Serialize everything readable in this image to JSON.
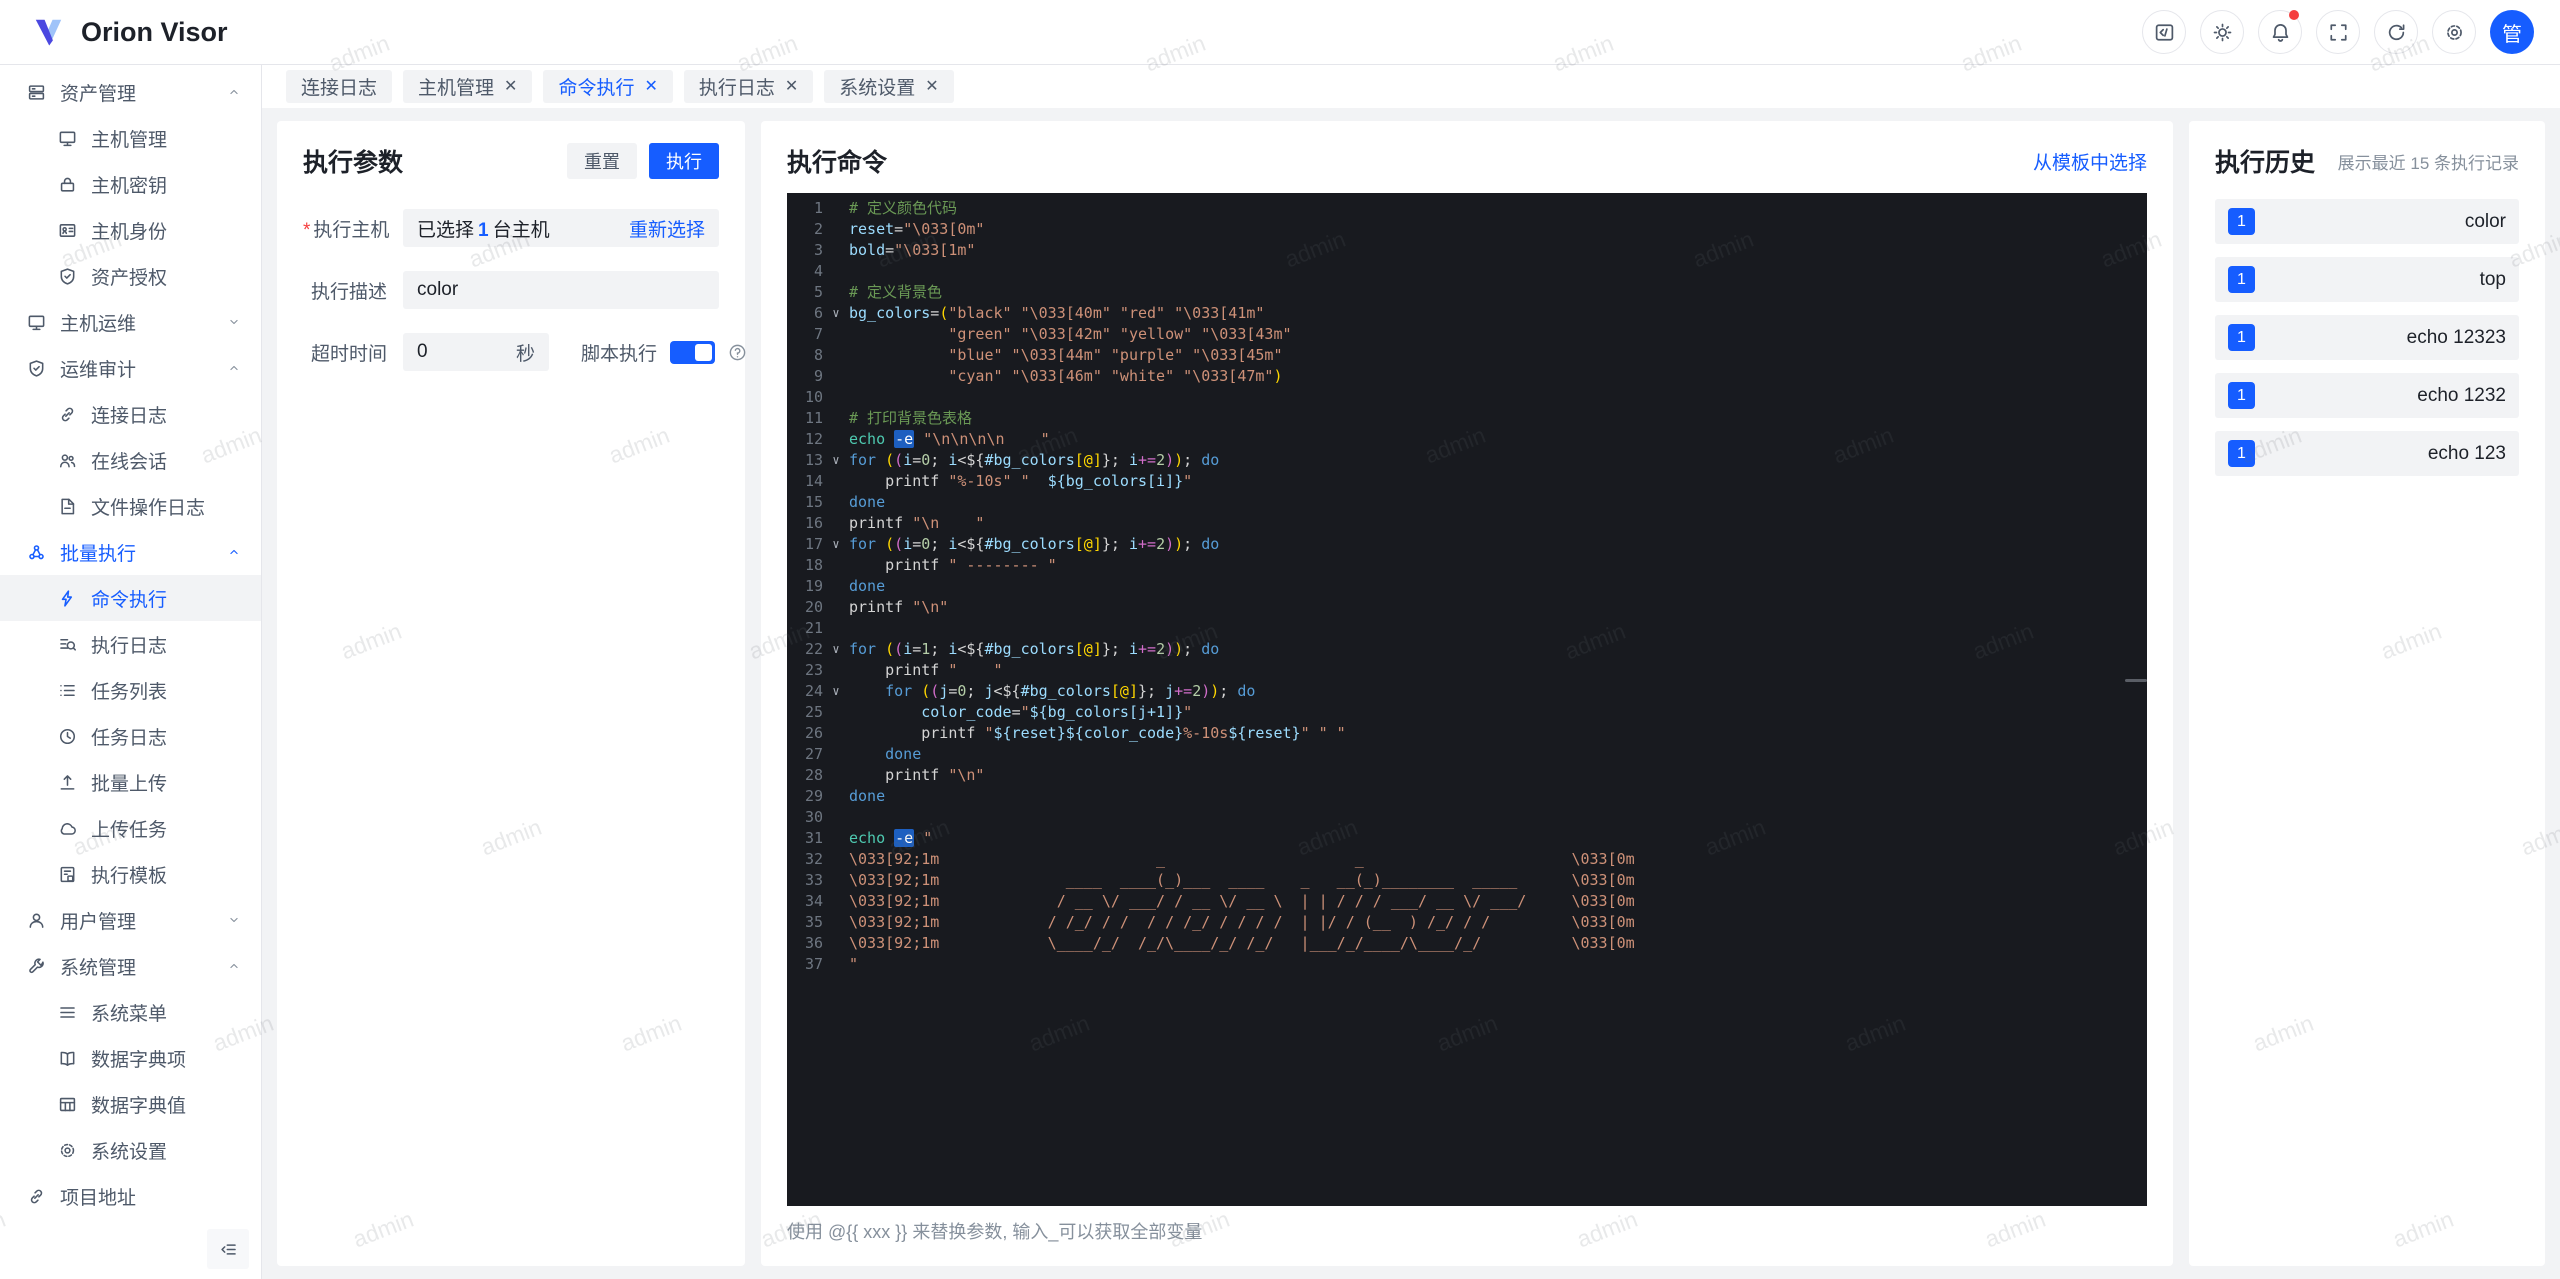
{
  "app": {
    "title": "Orion Visor",
    "avatar": "管"
  },
  "topbar": {
    "icons": [
      {
        "name": "code-square-icon",
        "icon": "codesq"
      },
      {
        "name": "theme-icon",
        "icon": "theme"
      },
      {
        "name": "notifications-icon",
        "icon": "bell",
        "badge": true
      },
      {
        "name": "fullscreen-icon",
        "icon": "fullscreen"
      },
      {
        "name": "refresh-icon",
        "icon": "refresh"
      },
      {
        "name": "settings-icon",
        "icon": "gear"
      }
    ]
  },
  "tabs": [
    {
      "label": "连接日志",
      "closable": false,
      "active": false
    },
    {
      "label": "主机管理",
      "closable": true,
      "active": false
    },
    {
      "label": "命令执行",
      "closable": true,
      "active": true
    },
    {
      "label": "执行日志",
      "closable": true,
      "active": false
    },
    {
      "label": "系统设置",
      "closable": true,
      "active": false
    }
  ],
  "sidebar": {
    "items": [
      {
        "label": "资产管理",
        "icon": "server",
        "level": 1,
        "chevron": "up"
      },
      {
        "label": "主机管理",
        "icon": "monitor",
        "level": 2
      },
      {
        "label": "主机密钥",
        "icon": "lock",
        "level": 2
      },
      {
        "label": "主机身份",
        "icon": "idcard",
        "level": 2
      },
      {
        "label": "资产授权",
        "icon": "shield",
        "level": 2
      },
      {
        "label": "主机运维",
        "icon": "monitor",
        "level": 1,
        "chevron": "down"
      },
      {
        "label": "运维审计",
        "icon": "shield",
        "level": 1,
        "chevron": "up"
      },
      {
        "label": "连接日志",
        "icon": "linkc",
        "level": 2
      },
      {
        "label": "在线会话",
        "icon": "users",
        "level": 2
      },
      {
        "label": "文件操作日志",
        "icon": "file",
        "level": 2
      },
      {
        "label": "批量执行",
        "icon": "cluster",
        "level": 1,
        "chevron": "up",
        "parent_active": true
      },
      {
        "label": "命令执行",
        "icon": "bolt",
        "level": 2,
        "active": true
      },
      {
        "label": "执行日志",
        "icon": "searchlist",
        "level": 2
      },
      {
        "label": "任务列表",
        "icon": "list",
        "level": 2
      },
      {
        "label": "任务日志",
        "icon": "clock",
        "level": 2
      },
      {
        "label": "批量上传",
        "icon": "upload",
        "level": 2
      },
      {
        "label": "上传任务",
        "icon": "cloud",
        "level": 2
      },
      {
        "label": "执行模板",
        "icon": "template",
        "level": 2
      },
      {
        "label": "用户管理",
        "icon": "user",
        "level": 1,
        "chevron": "down"
      },
      {
        "label": "系统管理",
        "icon": "wrench",
        "level": 1,
        "chevron": "up"
      },
      {
        "label": "系统菜单",
        "icon": "menu",
        "level": 2
      },
      {
        "label": "数据字典项",
        "icon": "book",
        "level": 2
      },
      {
        "label": "数据字典值",
        "icon": "tablei",
        "level": 2
      },
      {
        "label": "系统设置",
        "icon": "gear",
        "level": 2
      },
      {
        "label": "项目地址",
        "icon": "linkc",
        "level": 1
      }
    ]
  },
  "params": {
    "title": "执行参数",
    "reset_label": "重置",
    "run_label": "执行",
    "host_label": "执行主机",
    "host_prefix": "已选择",
    "host_count": "1",
    "host_suffix": "台主机",
    "host_link": "重新选择",
    "desc_label": "执行描述",
    "desc_value": "color",
    "timeout_label": "超时时间",
    "timeout_value": "0",
    "timeout_unit": "秒",
    "script_label": "脚本执行"
  },
  "command": {
    "title": "执行命令",
    "template_link": "从模板中选择",
    "hint": "使用 @{{ xxx }} 来替换参数, 输入_可以获取全部变量",
    "editor": {
      "lines": [
        {
          "t": [
            [
              "c",
              "# 定义颜色代码"
            ]
          ]
        },
        {
          "t": [
            [
              "v",
              "reset"
            ],
            [
              "w",
              "="
            ],
            [
              "s",
              "\"\\033[0m\""
            ]
          ]
        },
        {
          "t": [
            [
              "v",
              "bold"
            ],
            [
              "w",
              "="
            ],
            [
              "s",
              "\"\\033[1m\""
            ]
          ]
        },
        {
          "t": []
        },
        {
          "t": [
            [
              "c",
              "# 定义背景色"
            ]
          ]
        },
        {
          "f": 1,
          "t": [
            [
              "v",
              "bg_colors"
            ],
            [
              "w",
              "="
            ],
            [
              "g",
              "("
            ],
            [
              "s",
              "\"black\" \"\\033[40m\" \"red\" \"\\033[41m\""
            ]
          ]
        },
        {
          "t": [
            [
              "w",
              "           "
            ],
            [
              "s",
              "\"green\" \"\\033[42m\" \"yellow\" \"\\033[43m\""
            ]
          ]
        },
        {
          "t": [
            [
              "w",
              "           "
            ],
            [
              "s",
              "\"blue\" \"\\033[44m\" \"purple\" \"\\033[45m\""
            ]
          ]
        },
        {
          "t": [
            [
              "w",
              "           "
            ],
            [
              "s",
              "\"cyan\" \"\\033[46m\" \"white\" \"\\033[47m\""
            ],
            [
              "g",
              ")"
            ]
          ]
        },
        {
          "t": []
        },
        {
          "t": [
            [
              "c",
              "# 打印背景色表格"
            ]
          ]
        },
        {
          "t": [
            [
              "f",
              "echo"
            ],
            [
              "w",
              " "
            ],
            [
              "h",
              "-e"
            ],
            [
              "w",
              " "
            ],
            [
              "s",
              "\"\\n\\n\\n\\n    \""
            ]
          ]
        },
        {
          "f": 1,
          "t": [
            [
              "k",
              "for"
            ],
            [
              "w",
              " "
            ],
            [
              "g",
              "("
            ],
            [
              "m",
              "("
            ],
            [
              "v",
              "i"
            ],
            [
              "w",
              "="
            ],
            [
              "n",
              "0"
            ],
            [
              "w",
              "; "
            ],
            [
              "v",
              "i"
            ],
            [
              "w",
              "<"
            ],
            [
              "w",
              "${"
            ],
            [
              "v",
              "#bg_colors"
            ],
            [
              "g",
              "[@]"
            ],
            [
              "w",
              "}"
            ],
            [
              "w",
              "; "
            ],
            [
              "v",
              "i"
            ],
            [
              "m",
              "+="
            ],
            [
              "n",
              "2"
            ],
            [
              "m",
              ")"
            ],
            [
              "g",
              ")"
            ],
            [
              "w",
              "; "
            ],
            [
              "k",
              "do"
            ]
          ]
        },
        {
          "t": [
            [
              "w",
              "    "
            ],
            [
              "w",
              "printf"
            ],
            [
              "w",
              " "
            ],
            [
              "s",
              "\"%-10s\""
            ],
            [
              "w",
              " "
            ],
            [
              "s",
              "\"  "
            ],
            [
              "v",
              "${bg_colors[i]}"
            ],
            [
              "s",
              "\""
            ]
          ]
        },
        {
          "t": [
            [
              "k",
              "done"
            ]
          ]
        },
        {
          "t": [
            [
              "w",
              "printf"
            ],
            [
              "w",
              " "
            ],
            [
              "s",
              "\"\\n    \""
            ]
          ]
        },
        {
          "f": 1,
          "t": [
            [
              "k",
              "for"
            ],
            [
              "w",
              " "
            ],
            [
              "g",
              "("
            ],
            [
              "m",
              "("
            ],
            [
              "v",
              "i"
            ],
            [
              "w",
              "="
            ],
            [
              "n",
              "0"
            ],
            [
              "w",
              "; "
            ],
            [
              "v",
              "i"
            ],
            [
              "w",
              "<"
            ],
            [
              "w",
              "${"
            ],
            [
              "v",
              "#bg_colors"
            ],
            [
              "g",
              "[@]"
            ],
            [
              "w",
              "}"
            ],
            [
              "w",
              "; "
            ],
            [
              "v",
              "i"
            ],
            [
              "m",
              "+="
            ],
            [
              "n",
              "2"
            ],
            [
              "m",
              ")"
            ],
            [
              "g",
              ")"
            ],
            [
              "w",
              "; "
            ],
            [
              "k",
              "do"
            ]
          ]
        },
        {
          "t": [
            [
              "w",
              "    "
            ],
            [
              "w",
              "printf"
            ],
            [
              "w",
              " "
            ],
            [
              "s",
              "\" -------- \""
            ]
          ]
        },
        {
          "t": [
            [
              "k",
              "done"
            ]
          ]
        },
        {
          "t": [
            [
              "w",
              "printf"
            ],
            [
              "w",
              " "
            ],
            [
              "s",
              "\"\\n\""
            ]
          ]
        },
        {
          "t": []
        },
        {
          "f": 1,
          "t": [
            [
              "k",
              "for"
            ],
            [
              "w",
              " "
            ],
            [
              "g",
              "("
            ],
            [
              "m",
              "("
            ],
            [
              "v",
              "i"
            ],
            [
              "w",
              "="
            ],
            [
              "n",
              "1"
            ],
            [
              "w",
              "; "
            ],
            [
              "v",
              "i"
            ],
            [
              "w",
              "<"
            ],
            [
              "w",
              "${"
            ],
            [
              "v",
              "#bg_colors"
            ],
            [
              "g",
              "[@]"
            ],
            [
              "w",
              "}"
            ],
            [
              "w",
              "; "
            ],
            [
              "v",
              "i"
            ],
            [
              "m",
              "+="
            ],
            [
              "n",
              "2"
            ],
            [
              "m",
              ")"
            ],
            [
              "g",
              ")"
            ],
            [
              "w",
              "; "
            ],
            [
              "k",
              "do"
            ]
          ]
        },
        {
          "t": [
            [
              "w",
              "    "
            ],
            [
              "w",
              "printf"
            ],
            [
              "w",
              " "
            ],
            [
              "s",
              "\"    \""
            ]
          ]
        },
        {
          "f": 1,
          "t": [
            [
              "w",
              "    "
            ],
            [
              "k",
              "for"
            ],
            [
              "w",
              " "
            ],
            [
              "g",
              "("
            ],
            [
              "m",
              "("
            ],
            [
              "v",
              "j"
            ],
            [
              "w",
              "="
            ],
            [
              "n",
              "0"
            ],
            [
              "w",
              "; "
            ],
            [
              "v",
              "j"
            ],
            [
              "w",
              "<"
            ],
            [
              "w",
              "${"
            ],
            [
              "v",
              "#bg_colors"
            ],
            [
              "g",
              "[@]"
            ],
            [
              "w",
              "}"
            ],
            [
              "w",
              "; "
            ],
            [
              "v",
              "j"
            ],
            [
              "m",
              "+="
            ],
            [
              "n",
              "2"
            ],
            [
              "m",
              ")"
            ],
            [
              "g",
              ")"
            ],
            [
              "w",
              "; "
            ],
            [
              "k",
              "do"
            ]
          ]
        },
        {
          "t": [
            [
              "w",
              "        "
            ],
            [
              "v",
              "color_code"
            ],
            [
              "w",
              "="
            ],
            [
              "s",
              "\""
            ],
            [
              "v",
              "${bg_colors[j+1]}"
            ],
            [
              "s",
              "\""
            ]
          ]
        },
        {
          "t": [
            [
              "w",
              "        "
            ],
            [
              "w",
              "printf"
            ],
            [
              "w",
              " "
            ],
            [
              "s",
              "\""
            ],
            [
              "v",
              "${reset}${color_code}"
            ],
            [
              "s",
              "%-10s"
            ],
            [
              "v",
              "${reset}"
            ],
            [
              "s",
              "\""
            ],
            [
              "w",
              " "
            ],
            [
              "s",
              "\" \""
            ]
          ]
        },
        {
          "t": [
            [
              "w",
              "    "
            ],
            [
              "k",
              "done"
            ]
          ]
        },
        {
          "t": [
            [
              "w",
              "    "
            ],
            [
              "w",
              "printf"
            ],
            [
              "w",
              " "
            ],
            [
              "s",
              "\"\\n\""
            ]
          ]
        },
        {
          "t": [
            [
              "k",
              "done"
            ]
          ]
        },
        {
          "t": []
        },
        {
          "t": [
            [
              "f",
              "echo"
            ],
            [
              "w",
              " "
            ],
            [
              "h",
              "-e"
            ],
            [
              "w",
              " "
            ],
            [
              "s",
              "\""
            ]
          ]
        },
        {
          "t": [
            [
              "s",
              "\\033[92;1m                        _                     _                       \\033[0m"
            ]
          ]
        },
        {
          "t": [
            [
              "s",
              "\\033[92;1m              ____  ____(_)___  ____    _   __(_)________  _____      \\033[0m"
            ]
          ]
        },
        {
          "t": [
            [
              "s",
              "\\033[92;1m             / __ \\/ ___/ / __ \\/ __ \\  | | / / / ___/ __ \\/ ___/     \\033[0m"
            ]
          ]
        },
        {
          "t": [
            [
              "s",
              "\\033[92;1m            / /_/ / /  / / /_/ / / / /  | |/ / (__  ) /_/ / /         \\033[0m"
            ]
          ]
        },
        {
          "t": [
            [
              "s",
              "\\033[92;1m            \\____/_/  /_/\\____/_/ /_/   |___/_/____/\\____/_/          \\033[0m"
            ]
          ]
        },
        {
          "t": [
            [
              "s",
              "\""
            ]
          ]
        }
      ]
    }
  },
  "history": {
    "title": "执行历史",
    "subtitle": "展示最近 15 条执行记录",
    "items": [
      {
        "count": "1",
        "label": "color"
      },
      {
        "count": "1",
        "label": "top"
      },
      {
        "count": "1",
        "label": "echo 12323"
      },
      {
        "count": "1",
        "label": "echo 1232"
      },
      {
        "count": "1",
        "label": "echo 123"
      }
    ]
  },
  "watermark": {
    "text": "admin"
  },
  "colors": {
    "accent": "#165dff",
    "notification_dot": "#f53f3f",
    "editor_bg": "#181a1f"
  }
}
